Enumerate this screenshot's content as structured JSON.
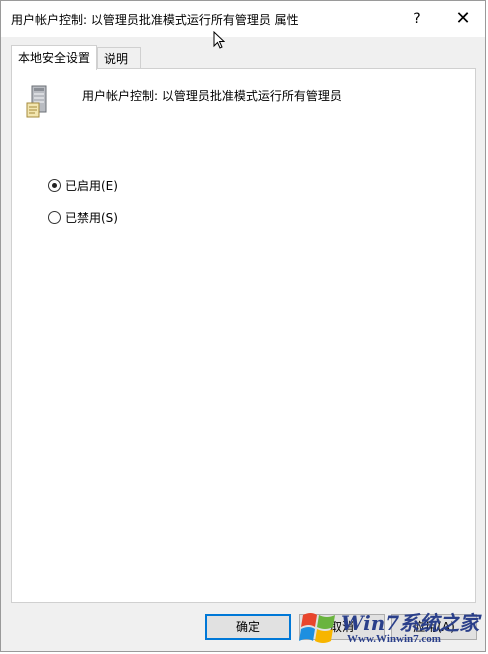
{
  "window": {
    "title": "用户帐户控制: 以管理员批准模式运行所有管理员 属性",
    "help_label": "?",
    "close_label": "✕"
  },
  "tabs": [
    {
      "label": "本地安全设置",
      "active": true
    },
    {
      "label": "说明",
      "active": false
    }
  ],
  "policy": {
    "icon": "server-policy-icon",
    "title": "用户帐户控制: 以管理员批准模式运行所有管理员"
  },
  "options": [
    {
      "label": "已启用(E)",
      "checked": true
    },
    {
      "label": "已禁用(S)",
      "checked": false
    }
  ],
  "buttons": {
    "ok": "确定",
    "cancel": "取消",
    "apply": "应用(A)"
  },
  "watermark": {
    "brand": "Win7系统之家",
    "url": "Www.Winwin7.com"
  },
  "colors": {
    "accent": "#0078d7",
    "panel": "#ffffff",
    "chrome": "#f0f0f0",
    "watermark": "#2a3f8a"
  }
}
